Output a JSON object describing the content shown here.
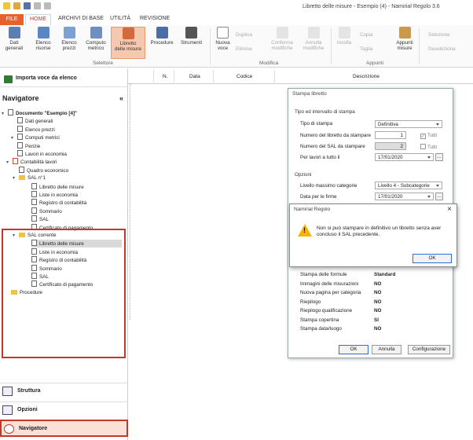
{
  "window": {
    "title": "Libretto delle misure - Esempio (4) - Namirial Regolo 3.6"
  },
  "tabs": [
    "FILE",
    "HOME",
    "ARCHIVI DI BASE",
    "UTILITÀ",
    "REVISIONE"
  ],
  "ribbon": {
    "buttons": [
      {
        "label": "Dati\ngenerali"
      },
      {
        "label": "Elenco\nrisorse"
      },
      {
        "label": "Elenco\nprezzi"
      },
      {
        "label": "Computo\nmetrico"
      },
      {
        "label": "Libretto\ndelle misure"
      },
      {
        "label": "Procedure"
      },
      {
        "label": "Strumenti"
      },
      {
        "label": "Nuova\nvoce"
      },
      {
        "label": "Conferma\nmodifiche"
      },
      {
        "label": "Annulla\nmodifiche"
      },
      {
        "label": "Incolla"
      },
      {
        "label": "Appunti\nmisure"
      }
    ],
    "small": {
      "duplica": "Duplica",
      "elimina": "Elimina",
      "copia": "Copia",
      "taglia": "Taglia",
      "selezione": "Selezione",
      "deseleziona": "Deseleziona"
    },
    "groups": {
      "selettore": "Selettore",
      "modifica": "Modifica",
      "appunti": "Appunti"
    }
  },
  "left": {
    "import_label": "Importa voce da elenco",
    "nav_title": "Navigatore",
    "collapse": "«",
    "tree": [
      {
        "label": "Documento \"Esempio [4]\"",
        "bold": true
      },
      {
        "label": "Dati generali"
      },
      {
        "label": "Elenco prezzi"
      },
      {
        "label": "Computi metrici"
      },
      {
        "label": "Perizie"
      },
      {
        "label": "Lavori in economia"
      },
      {
        "label": "Contabilità lavori"
      },
      {
        "label": "Quadro economico"
      },
      {
        "label": "SAL n°1"
      },
      {
        "label": "Libretto delle misure"
      },
      {
        "label": "Liste in economia"
      },
      {
        "label": "Registro di contabilità"
      },
      {
        "label": "Sommario"
      },
      {
        "label": "SAL"
      },
      {
        "label": "Certificato di pagamento"
      },
      {
        "label": "SAL corrente"
      },
      {
        "label": "Libretto delle misure"
      },
      {
        "label": "Liste in economia"
      },
      {
        "label": "Registro di contabilità"
      },
      {
        "label": "Sommario"
      },
      {
        "label": "SAL"
      },
      {
        "label": "Certificato di pagamento"
      },
      {
        "label": "Procedure"
      }
    ],
    "bottom": {
      "struttura": "Struttura",
      "opzioni": "Opzioni",
      "navigatore": "Navigatore"
    }
  },
  "grid": {
    "columns": [
      "N.",
      "Data",
      "Codice",
      "Descrizione"
    ]
  },
  "print_dialog": {
    "title": "Stampa libretto",
    "section1": "Tipo ed intervallo di stampa",
    "tipo_label": "Tipo di stampa",
    "tipo_value": "Definitiva",
    "num_libretto_label": "Numero del libretto da stampare",
    "num_libretto_value": "1",
    "num_sal_label": "Numero del SAL da stampare",
    "num_sal_value": "2",
    "tutti": "Tutti",
    "per_lavori_label": "Per lavori a tutto il",
    "per_lavori_value": "17/01/2020",
    "section2": "Opzioni",
    "livello_label": "Livello massimo categorie",
    "livello_value": "Livello 4 - Subcategorie",
    "data_firme_label": "Data per le firme",
    "data_firme_value": "17/01/2020",
    "options": [
      {
        "k": "Stampa delle formule",
        "v": "Standard"
      },
      {
        "k": "Immagini delle misurazioni",
        "v": "NO"
      },
      {
        "k": "Nuova pagina per categoria",
        "v": "NO"
      },
      {
        "k": "Riepilogo",
        "v": "NO"
      },
      {
        "k": "Riepilogo qualificazione",
        "v": "NO"
      },
      {
        "k": "Stampa copertina",
        "v": "SI"
      },
      {
        "k": "Stampa data/luogo",
        "v": "NO"
      }
    ],
    "ok": "OK",
    "annulla": "Annulla",
    "configurazione": "Configurazione"
  },
  "alert": {
    "title": "Namirial Regolo",
    "close": "×",
    "message": "Non si può stampare in definitivo un libretto senza aver concluso il SAL precedente.",
    "ok": "OK"
  },
  "colors": {
    "file_tab": "#e8612c",
    "highlight": "#c0392b",
    "active_btn": "#f5c9b0"
  }
}
